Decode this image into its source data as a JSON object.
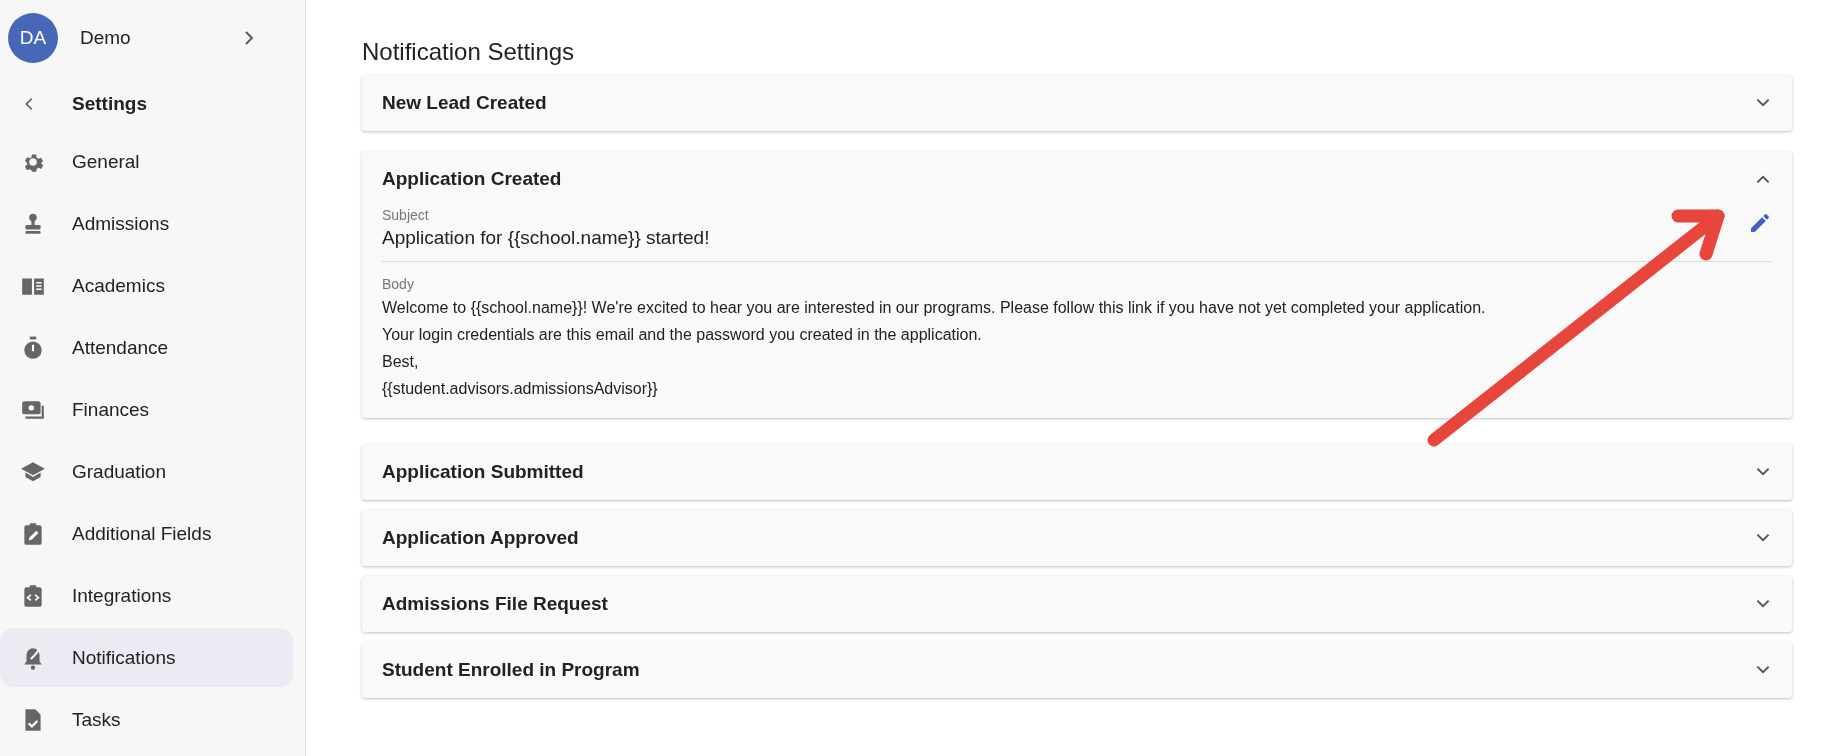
{
  "account": {
    "initials": "DA",
    "name": "Demo"
  },
  "sidebar": {
    "title": "Settings",
    "items": [
      {
        "label": "General",
        "selected": false
      },
      {
        "label": "Admissions",
        "selected": false
      },
      {
        "label": "Academics",
        "selected": false
      },
      {
        "label": "Attendance",
        "selected": false
      },
      {
        "label": "Finances",
        "selected": false
      },
      {
        "label": "Graduation",
        "selected": false
      },
      {
        "label": "Additional Fields",
        "selected": false
      },
      {
        "label": "Integrations",
        "selected": false
      },
      {
        "label": "Notifications",
        "selected": true
      },
      {
        "label": "Tasks",
        "selected": false
      }
    ]
  },
  "main": {
    "title": "Notification Settings",
    "panels": [
      {
        "title": "New Lead Created",
        "expanded": false
      },
      {
        "title": "Application Created",
        "expanded": true,
        "subject_label": "Subject",
        "subject": "Application for {{school.name}} started!",
        "body_label": "Body",
        "body": [
          "Welcome to {{school.name}}! We're excited to hear you are interested in our programs. Please follow this link if you have not yet completed your application.",
          "Your login credentials are this email and the password you created in the application.",
          "Best,",
          "{{student.advisors.admissionsAdvisor}}"
        ]
      },
      {
        "title": "Application Submitted",
        "expanded": false
      },
      {
        "title": "Application Approved",
        "expanded": false
      },
      {
        "title": "Admissions File Request",
        "expanded": false
      },
      {
        "title": "Student Enrolled in Program",
        "expanded": false
      }
    ]
  }
}
